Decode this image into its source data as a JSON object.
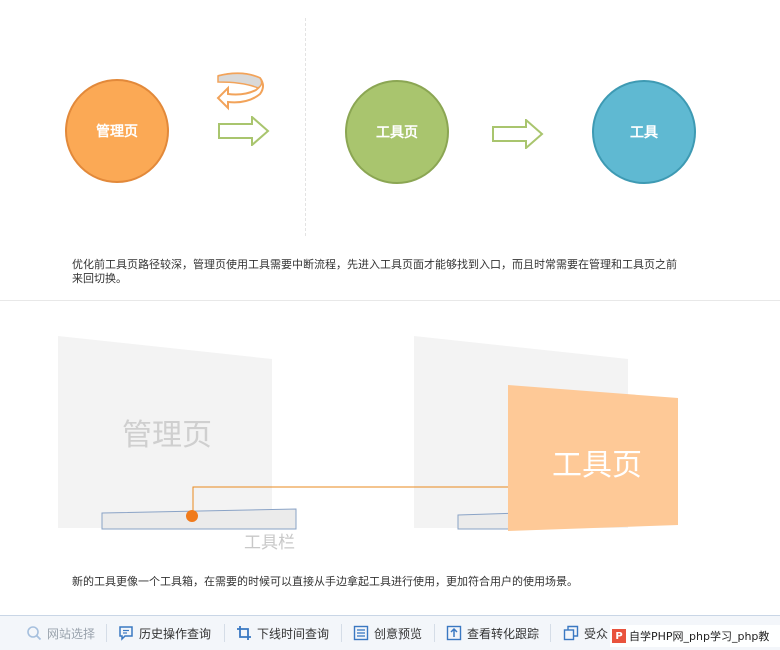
{
  "top_flow": {
    "circle_manage": "管理页",
    "circle_tool_page": "工具页",
    "circle_tool": "工具",
    "colors": {
      "manage": "#fba955",
      "tool_page": "#a9c56e",
      "tool": "#5fb9d2"
    },
    "description": "优化前工具页路径较深，管理页使用工具需要中断流程，先进入工具页面才能够找到入口，而且时常需要在管理和工具页之前来回切换。"
  },
  "bottom_flow": {
    "manage_panel_label": "管理页",
    "toolbar_label": "工具栏",
    "tool_panel_label": "工具页",
    "colors": {
      "tool_panel": "#fec997",
      "connector": "#e98a1e"
    },
    "description": "新的工具更像一个工具箱，在需要的时候可以直接从手边拿起工具进行使用，更加符合用户的使用场景。"
  },
  "toolbar": {
    "items": [
      {
        "label": "网站选择",
        "icon": "search-icon"
      },
      {
        "label": "历史操作查询",
        "icon": "chat-icon"
      },
      {
        "label": "下线时间查询",
        "icon": "crop-icon"
      },
      {
        "label": "创意预览",
        "icon": "list-icon"
      },
      {
        "label": "查看转化跟踪",
        "icon": "upload-icon"
      },
      {
        "label": "受众",
        "icon": "copy-icon"
      }
    ]
  },
  "watermark": {
    "logo": "P",
    "text": "自学PHP网_php学习_php教"
  }
}
